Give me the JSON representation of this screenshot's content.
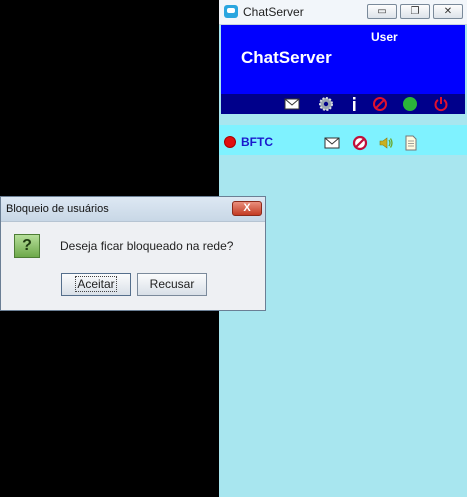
{
  "window": {
    "title": "ChatServer",
    "minimize_glyph": "▭",
    "restore_glyph": "❐",
    "close_glyph": "✕"
  },
  "header": {
    "user_label": "User",
    "app_name": "ChatServer"
  },
  "toolbar": {
    "icons": [
      "mail-icon",
      "settings-gear-icon",
      "info-icon",
      "block-icon",
      "status-online-icon",
      "power-icon"
    ]
  },
  "users": [
    {
      "name": "BFTC",
      "status_color": "#e01010",
      "icons": [
        "mail-icon",
        "block-icon",
        "speaker-icon",
        "document-icon"
      ]
    }
  ],
  "dialog": {
    "title": "Bloqueio de usuários",
    "close_glyph": "X",
    "icon_glyph": "?",
    "message": "Deseja ficar bloqueado na rede?",
    "accept_label": "Aceitar",
    "reject_label": "Recusar"
  }
}
